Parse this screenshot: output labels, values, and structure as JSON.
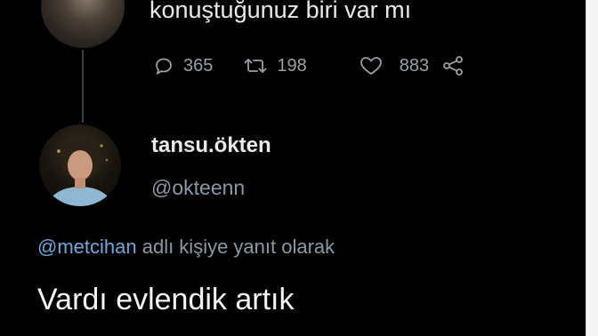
{
  "tweet": {
    "text": "konuştuğunuz biri var mı",
    "stats": {
      "replies": "365",
      "retweets": "198",
      "likes": "883"
    }
  },
  "reply": {
    "display_name": "tansu.ökten",
    "handle": "@okteenn",
    "replying_to": {
      "mention": "@metcihan",
      "suffix": " adlı kişiye yanıt olarak"
    },
    "text": "Vardı evlendik artık"
  },
  "icons": [
    "reply-icon",
    "retweet-icon",
    "like-icon",
    "share-icon"
  ],
  "colors": {
    "background": "#000000",
    "text": "#e7e9ea",
    "muted": "#8b98a5",
    "mention": "#6fa8dc"
  }
}
